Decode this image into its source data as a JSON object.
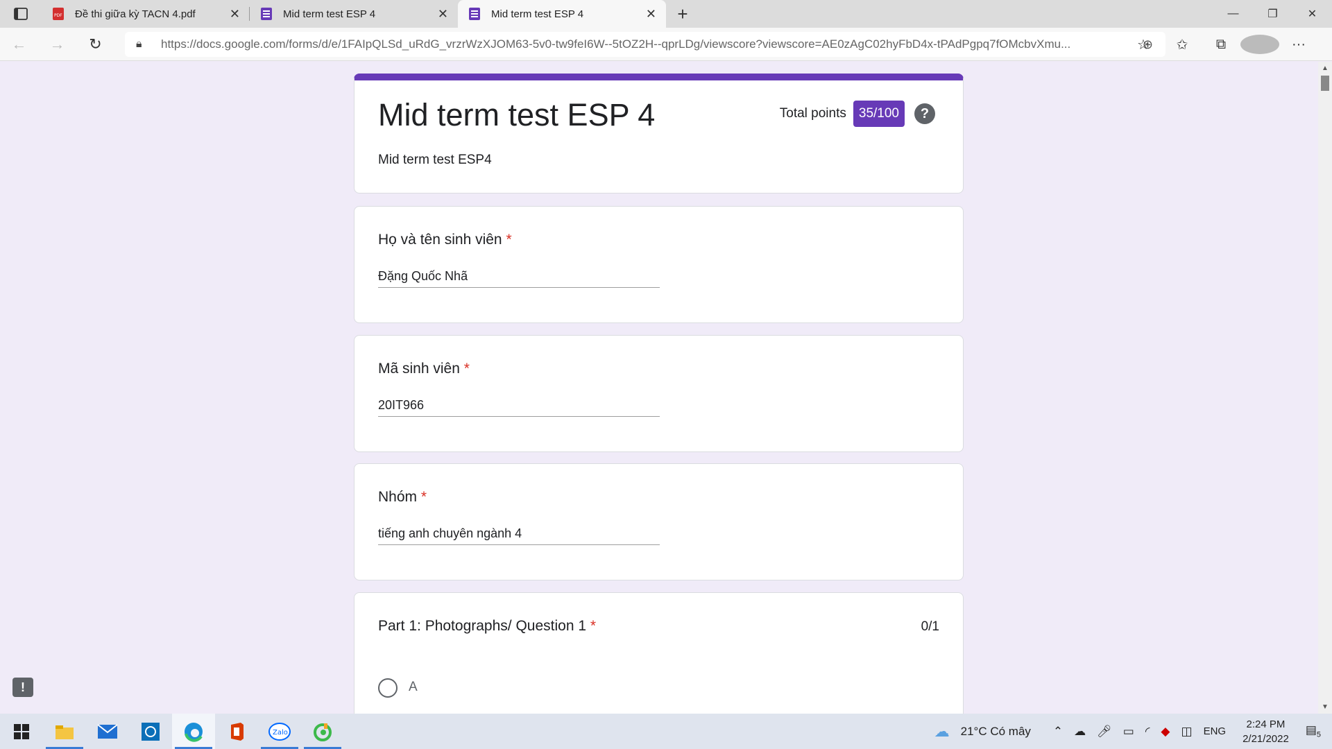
{
  "browser": {
    "tabs": [
      {
        "label": "Đề thi giữa kỳ TACN 4.pdf",
        "icon": "pdf-icon"
      },
      {
        "label": "Mid term test ESP 4",
        "icon": "forms-icon"
      },
      {
        "label": "Mid term test ESP 4",
        "icon": "forms-icon"
      }
    ],
    "url": "https://docs.google.com/forms/d/e/1FAIpQLSd_uRdG_vrzrWzXJOM63-5v0-tw9feI6W--5tOZ2H--qprLDg/viewscore?viewscore=AE0zAgC02hyFbD4x-tPAdPgpq7fOMcbvXmu...",
    "new_tab_glyph": "+"
  },
  "form": {
    "accent": "#673ab7",
    "title": "Mid term test ESP 4",
    "description": "Mid term test ESP4",
    "total_points_label": "Total points",
    "total_points_value": "35/100",
    "help_glyph": "?",
    "questions": [
      {
        "label": "Họ và tên sinh viên",
        "answer": "Đặng Quốc Nhã"
      },
      {
        "label": "Mã sinh viên",
        "answer": "20IT966"
      },
      {
        "label": "Nhóm",
        "answer": "tiếng anh chuyên ngành 4"
      }
    ],
    "part1": {
      "label": "Part 1: Photographs/ Question 1",
      "points": "0/1",
      "option": "A"
    },
    "required_mark": "*"
  },
  "taskbar": {
    "weather": "21°C  Có mây",
    "lang": "ENG",
    "time": "2:24 PM",
    "date": "2/21/2022",
    "notif_count": "5"
  }
}
